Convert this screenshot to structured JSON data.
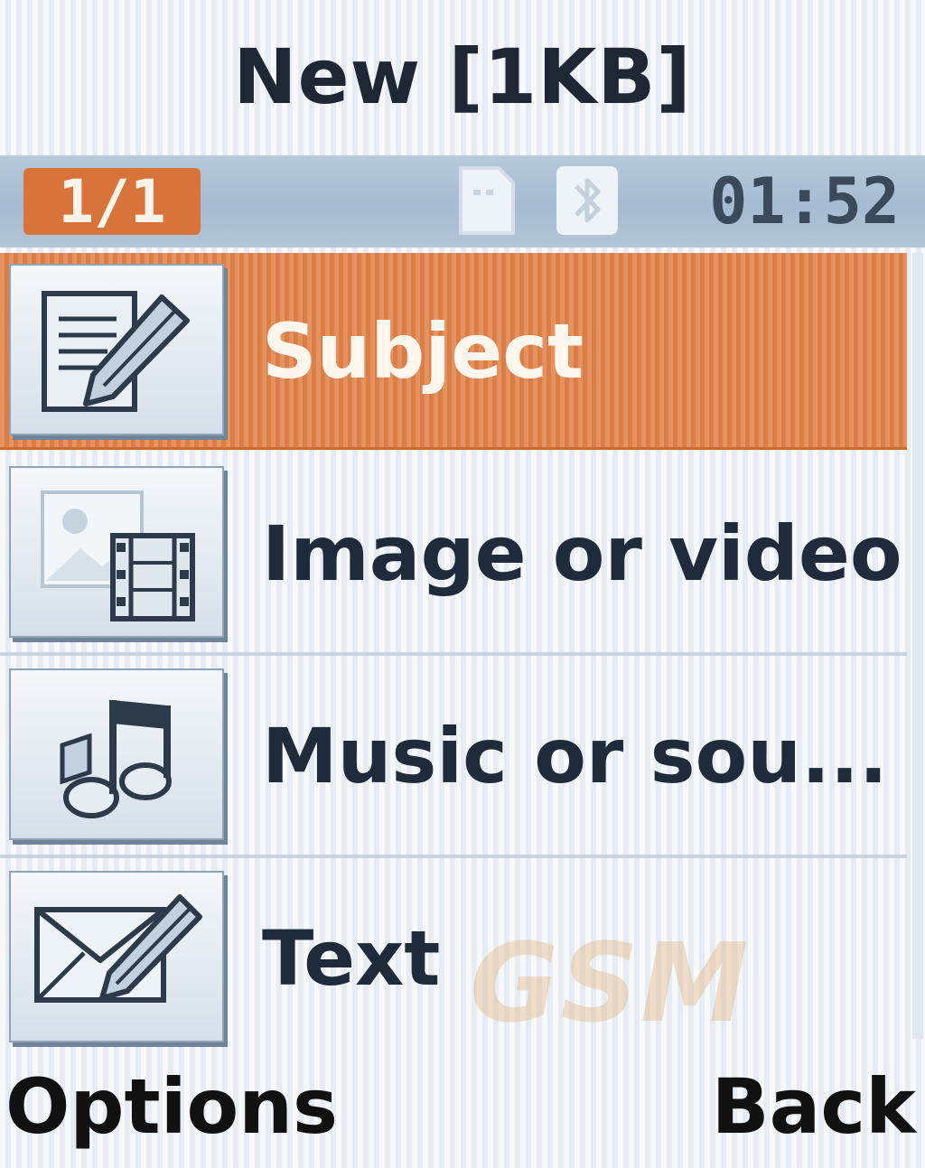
{
  "title_bar": {
    "title": "New [1KB]"
  },
  "status_bar": {
    "page_indicator": "1/1",
    "icons": [
      "memory-card-icon",
      "bluetooth-icon"
    ],
    "clock": "01:52"
  },
  "menu": {
    "items": [
      {
        "label": "Subject",
        "icon": "edit-document-icon",
        "selected": true
      },
      {
        "label": "Image or video",
        "icon": "image-video-icon",
        "selected": false
      },
      {
        "label": "Music or sou...",
        "icon": "music-icon",
        "selected": false
      },
      {
        "label": "Text",
        "icon": "envelope-pen-icon",
        "selected": false
      }
    ]
  },
  "watermark": "GSM",
  "softkeys": {
    "left": "Options",
    "right": "Back"
  },
  "colors": {
    "accent": "#e2834a",
    "status_bar": "#a5bbd1",
    "text": "#1f2b3a"
  }
}
